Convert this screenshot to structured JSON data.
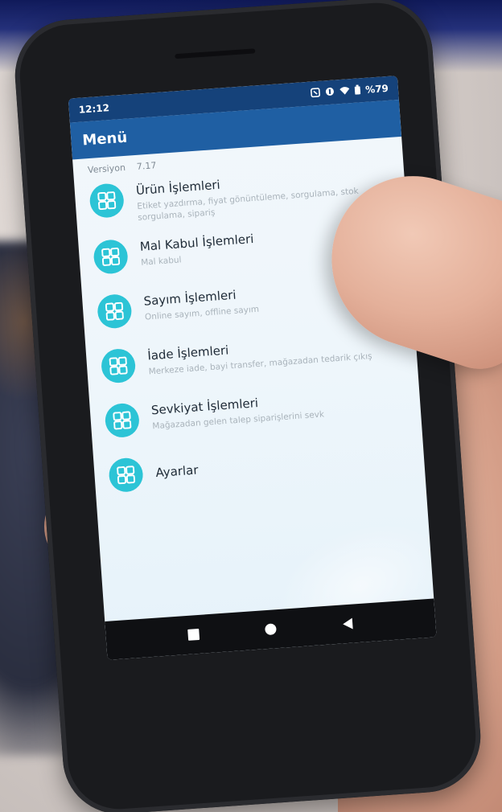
{
  "status_bar": {
    "time": "12:12",
    "battery": "%79"
  },
  "app_bar": {
    "title": "Menü"
  },
  "version": {
    "label": "Versiyon",
    "value": "7.17"
  },
  "menu": {
    "items": [
      {
        "title": "Ürün İşlemleri",
        "subtitle": "Etiket yazdırma, fiyat gönüntüleme, sorgulama, stok sorgulama, sipariş",
        "icon": "grid-icon"
      },
      {
        "title": "Mal Kabul İşlemleri",
        "subtitle": "Mal kabul",
        "icon": "grid-icon"
      },
      {
        "title": "Sayım İşlemleri",
        "subtitle": "Online sayım, offline sayım",
        "icon": "grid-icon"
      },
      {
        "title": "İade İşlemleri",
        "subtitle": "Merkeze iade, bayi transfer, mağazadan tedarik çıkış",
        "icon": "grid-icon"
      },
      {
        "title": "Sevkiyat İşlemleri",
        "subtitle": "Mağazadan gelen talep siparişlerini sevk",
        "icon": "grid-icon"
      },
      {
        "title": "Ayarlar",
        "subtitle": "",
        "icon": "grid-icon"
      }
    ]
  },
  "colors": {
    "status_bar": "#15427a",
    "app_bar": "#1f5fa3",
    "icon_circle": "#2cc4d6",
    "screen_bg": "#eef6fb"
  }
}
